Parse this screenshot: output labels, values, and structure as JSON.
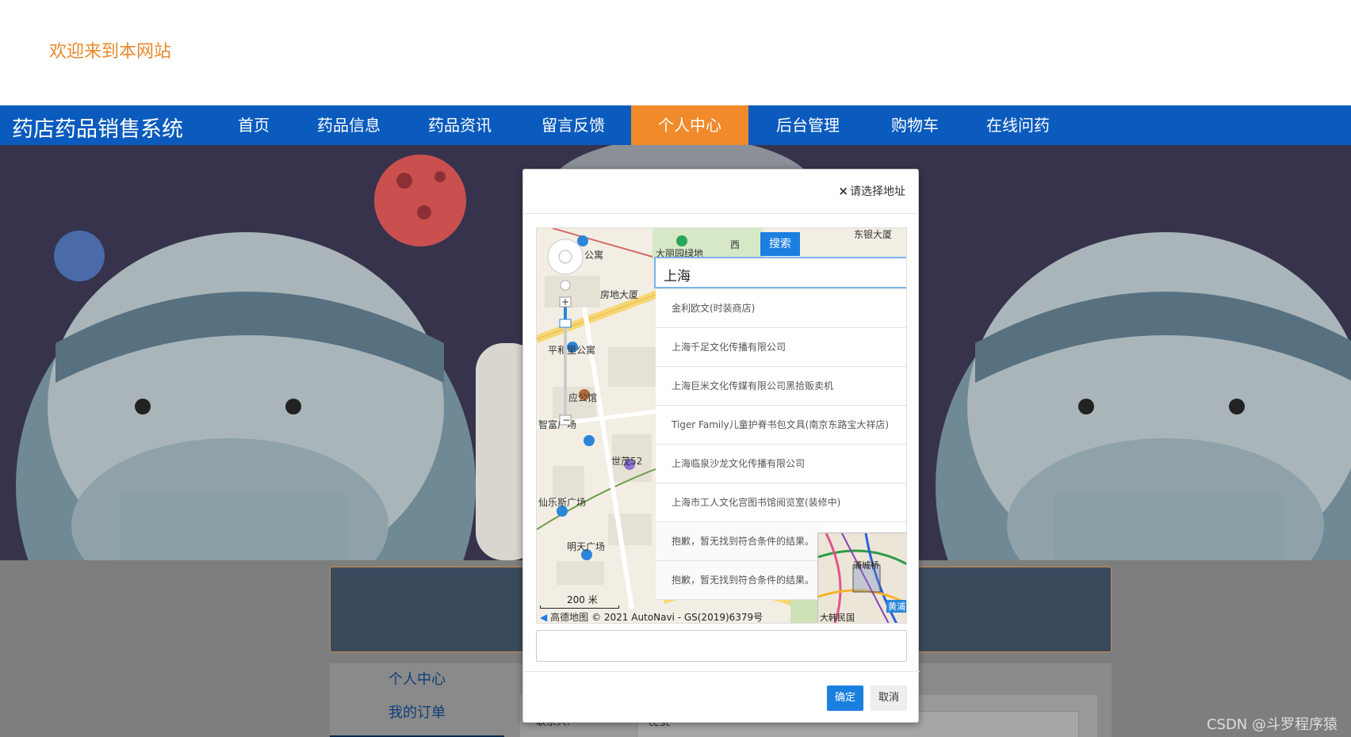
{
  "header": {
    "welcome": "欢迎来到本网站"
  },
  "nav": {
    "brand": "药店药品销售系统",
    "items": [
      {
        "label": "首页"
      },
      {
        "label": "药品信息"
      },
      {
        "label": "药品资讯"
      },
      {
        "label": "留言反馈"
      },
      {
        "label": "个人中心"
      },
      {
        "label": "后台管理"
      },
      {
        "label": "购物车"
      },
      {
        "label": "在线问药"
      }
    ],
    "active_index": 4,
    "colors": {
      "bar": "#0a5bbd",
      "active": "#f08a2a"
    }
  },
  "sidebar": {
    "items": [
      {
        "label": "个人中心"
      },
      {
        "label": "我的订单"
      }
    ]
  },
  "form": {
    "contact_label": "联系人:",
    "contact_value": "test"
  },
  "modal": {
    "title": "请选择地址",
    "search_button": "搜索",
    "search_value": "上海",
    "suggestions": [
      "金利欧文(时装商店)",
      "上海千足文化传播有限公司",
      "上海巨米文化传媒有限公司黑拾贩卖机",
      "Tiger Family儿童护脊书包文具(南京东路宝大祥店)",
      "上海临泉沙龙文化传播有限公司",
      "上海市工人文化宫图书馆阅览室(装修中)",
      "抱歉，暂无找到符合条件的结果。",
      "抱歉，暂无找到符合条件的结果。"
    ],
    "map_labels": {
      "l1": "东银大厦",
      "l2": "公寓",
      "l3": "房地大厦",
      "l4": "平和里公寓",
      "l5": "应公馆",
      "l6": "智富广场",
      "l7": "世茂52",
      "l8": "仙乐斯广场",
      "l9": "明天广场",
      "l10": "西",
      "l11": "大丽园绿地",
      "l12": "浦城桥",
      "l13": "大韩民国",
      "l14": "黄浦"
    },
    "scale": "200 米",
    "map_brand": "高德地图",
    "copyright": "© 2021 AutoNavi - GS(2019)6379号",
    "ok": "确定",
    "cancel": "取消"
  },
  "watermark": "CSDN @斗罗程序猿"
}
